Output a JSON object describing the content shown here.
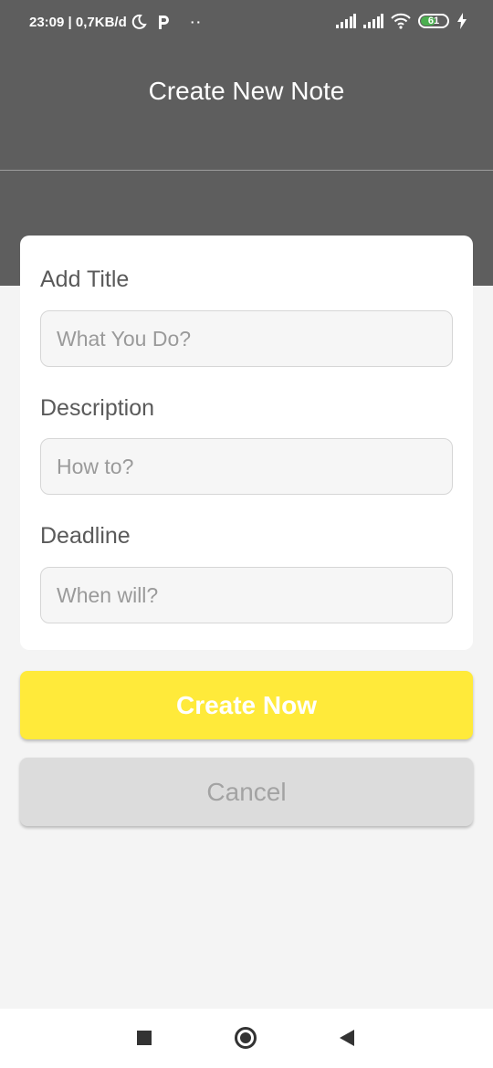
{
  "status_bar": {
    "time_data": "23:09 | 0,7KB/d",
    "dots": "··",
    "battery_level": "61",
    "battery_fraction": 0.61,
    "battery_color": "#4caf50"
  },
  "header": {
    "title": "Create New Note",
    "background_color": "#5e5e5e"
  },
  "form": {
    "fields": [
      {
        "label": "Add Title",
        "placeholder": "What You Do?",
        "value": ""
      },
      {
        "label": "Description",
        "placeholder": "How to?",
        "value": ""
      },
      {
        "label": "Deadline",
        "placeholder": "When will?",
        "value": ""
      }
    ]
  },
  "buttons": {
    "create_label": "Create Now",
    "create_color": "#ffea3a",
    "cancel_label": "Cancel",
    "cancel_color": "#dcdcdc"
  },
  "nav_bar": {
    "icons": [
      "recents-square-icon",
      "home-circle-icon",
      "back-triangle-icon"
    ]
  }
}
